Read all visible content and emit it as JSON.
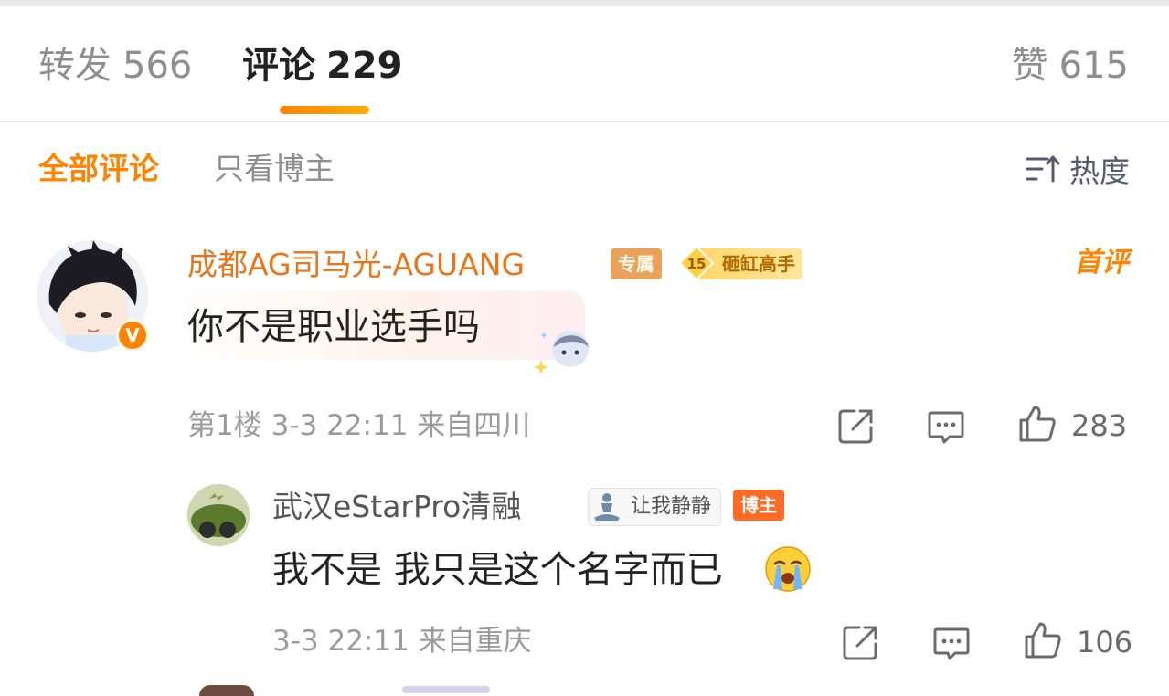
{
  "tabs": {
    "repost": {
      "label": "转发",
      "count": "566"
    },
    "comment": {
      "label": "评论",
      "count": "229"
    },
    "like": {
      "label": "赞",
      "count": "615"
    }
  },
  "filters": {
    "all": "全部评论",
    "blogger_only": "只看博主",
    "sort": "热度"
  },
  "comments": [
    {
      "user": "成都AG司马光-AGUANG",
      "badges": [
        "专属",
        "15",
        "砸缸高手"
      ],
      "tag": "首评",
      "text": "你不是职业选手吗",
      "floor": "第1楼",
      "time": "3-3 22:11",
      "location": "来自四川",
      "likes": "283"
    },
    {
      "user": "武汉eStarPro清融",
      "mood": "让我静静",
      "role_badge": "博主",
      "text": "我不是 我只是这个名字而已",
      "time": "3-3 22:11",
      "location": "来自重庆",
      "likes": "106"
    }
  ],
  "colors": {
    "accent": "#ff8200",
    "username": "#e8751a",
    "meta": "#9a9a9a",
    "blogger_badge": "#ff6a25"
  },
  "icons": [
    "share-icon",
    "comment-icon",
    "like-icon",
    "sort-icon",
    "verified-icon",
    "crying-emoji-icon",
    "meditate-icon"
  ]
}
